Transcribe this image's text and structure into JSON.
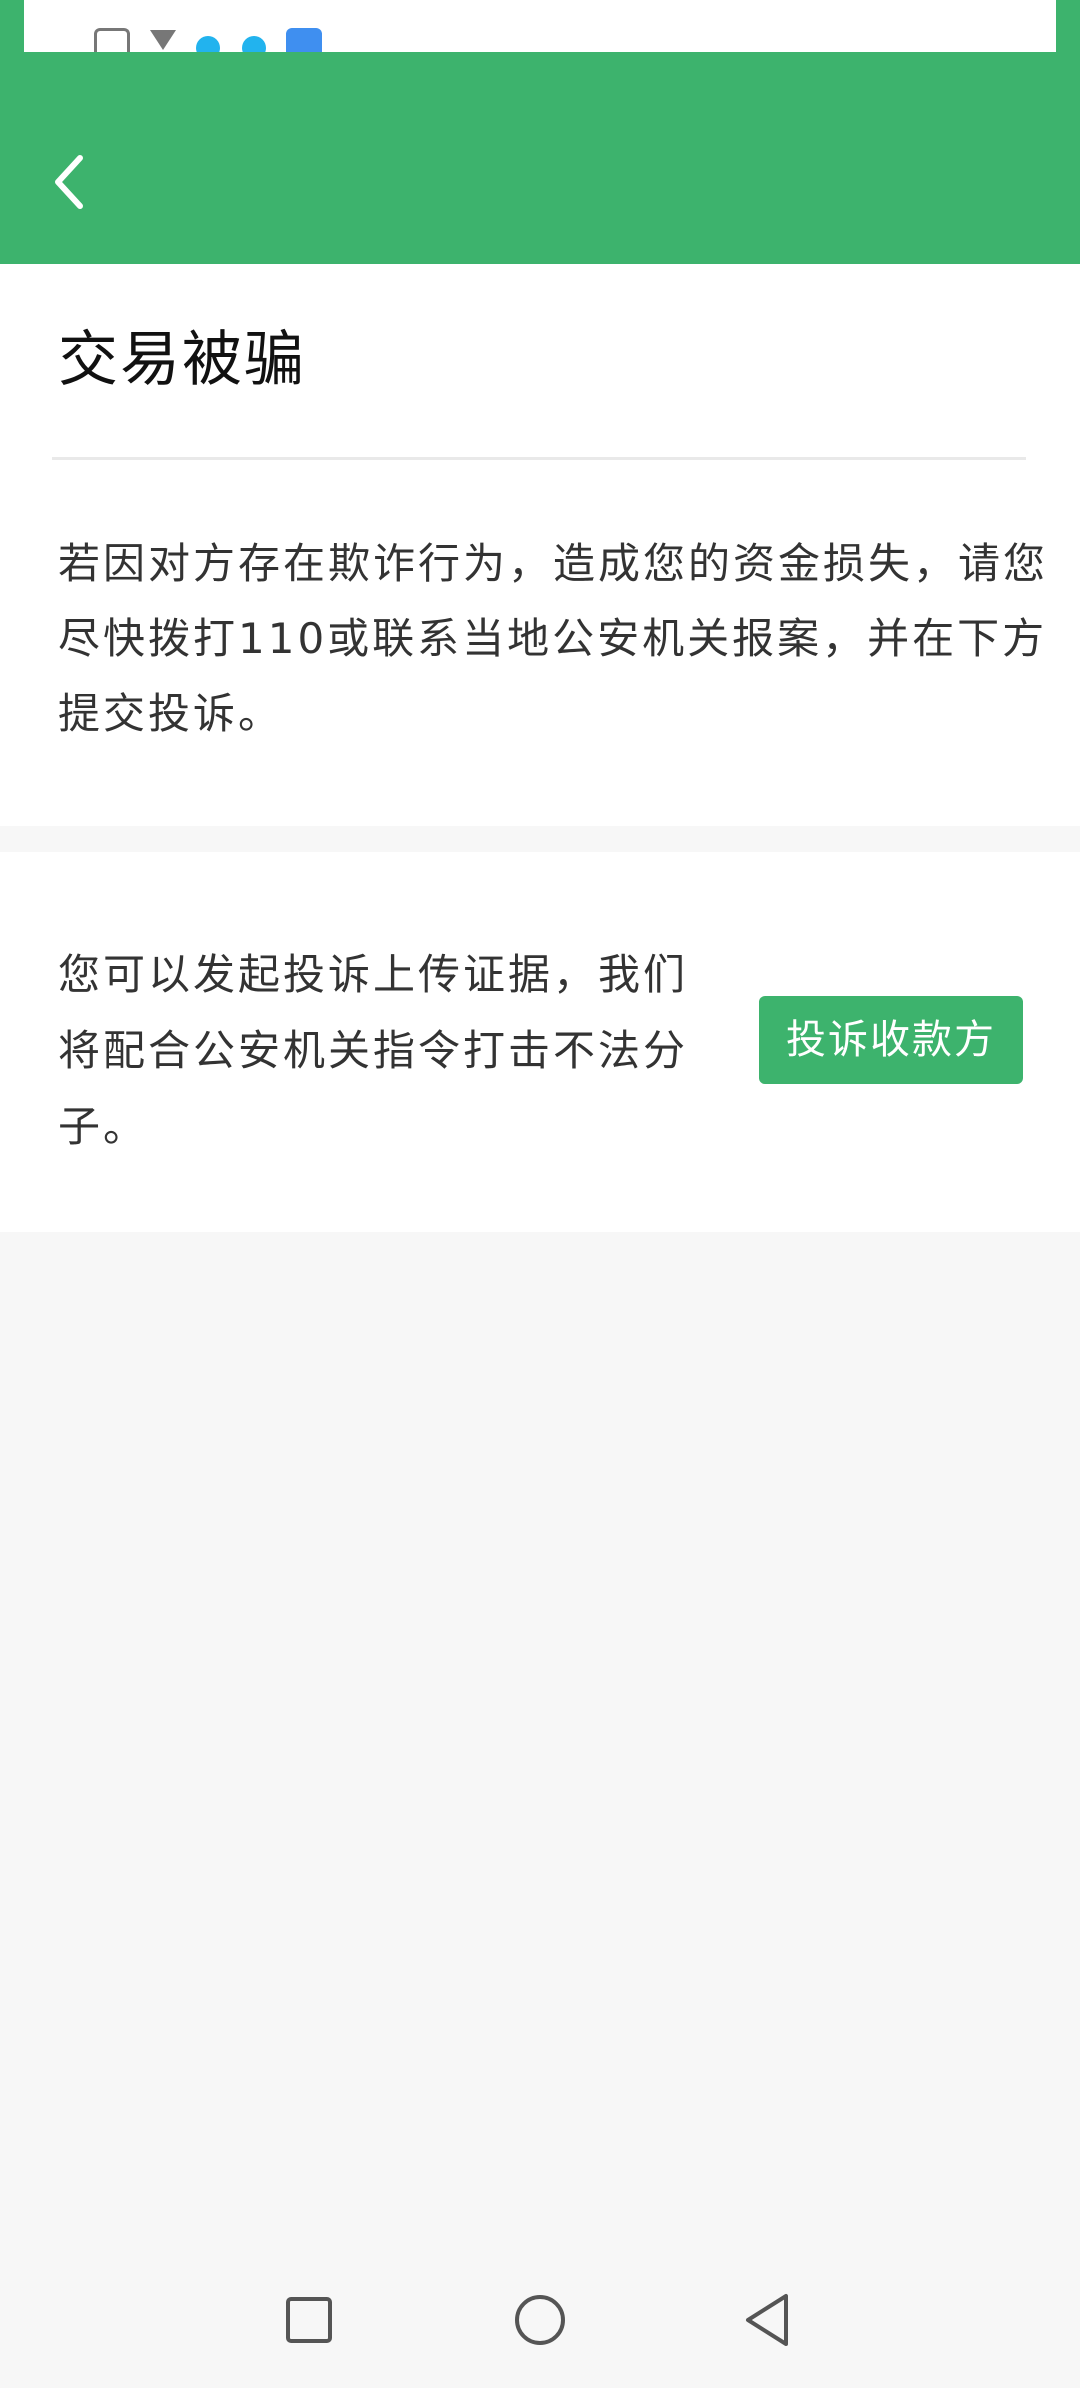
{
  "header": {
    "background_color": "#3db36d",
    "back_icon": "chevron-left-icon"
  },
  "status_bar": {
    "icons": [
      "app-icon",
      "download-icon",
      "notification-dot-icon",
      "notification-dot-icon",
      "cloud-icon"
    ]
  },
  "section_main": {
    "title": "交易被骗",
    "description": "若因对方存在欺诈行为，造成您的资金损失，请您尽快拨打110或联系当地公安机关报案，并在下方提交投诉。"
  },
  "section_complaint": {
    "text": "您可以发起投诉上传证据，我们将配合公安机关指令打击不法分子。",
    "button_label": "投诉收款方",
    "button_color": "#3db36d"
  },
  "nav_bar": {
    "buttons": [
      "recents-square-icon",
      "home-circle-icon",
      "back-triangle-icon"
    ]
  }
}
